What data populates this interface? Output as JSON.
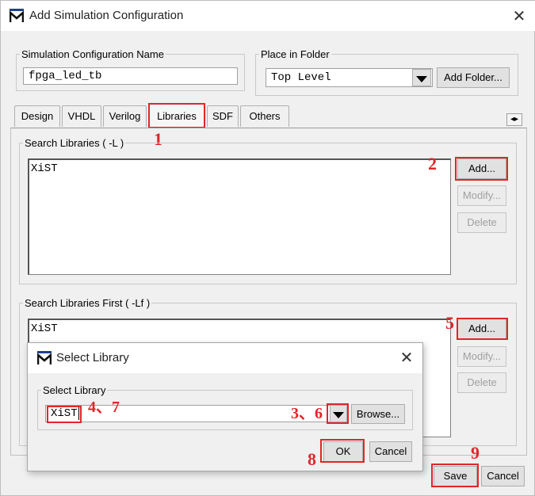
{
  "window": {
    "title": "Add Simulation Configuration",
    "close_glyph": "✕",
    "logo_icon": "modelsim-logo-icon"
  },
  "config_name": {
    "label": "Simulation Configuration Name",
    "value": "fpga_led_tb"
  },
  "folder": {
    "label": "Place in Folder",
    "value": "Top Level",
    "add_folder_label": "Add Folder..."
  },
  "tabs": [
    {
      "label": "Design"
    },
    {
      "label": "VHDL"
    },
    {
      "label": "Verilog"
    },
    {
      "label": "Libraries"
    },
    {
      "label": "SDF"
    },
    {
      "label": "Others"
    }
  ],
  "tabs_selected": "Libraries",
  "tab_scroll_glyph": "◂▸",
  "search_libs": {
    "label": "Search Libraries ( -L )",
    "items": [
      "XiST"
    ],
    "add_label": "Add...",
    "modify_label": "Modify...",
    "delete_label": "Delete"
  },
  "search_libs_first": {
    "label": "Search Libraries First ( -Lf )",
    "items": [
      "XiST"
    ],
    "add_label": "Add...",
    "modify_label": "Modify...",
    "delete_label": "Delete"
  },
  "footer": {
    "save_label": "Save",
    "cancel_label": "Cancel"
  },
  "dialog": {
    "title": "Select Library",
    "close_glyph": "✕",
    "group_label": "Select Library",
    "value": "XiST",
    "browse_label": "Browse...",
    "ok_label": "OK",
    "cancel_label": "Cancel"
  },
  "annotations": {
    "n1": "1",
    "n2": "2",
    "n3_6": "3、6",
    "n4_7": "4、7",
    "n5": "5",
    "n8": "8",
    "n9": "9",
    "color": "#e0262b"
  }
}
